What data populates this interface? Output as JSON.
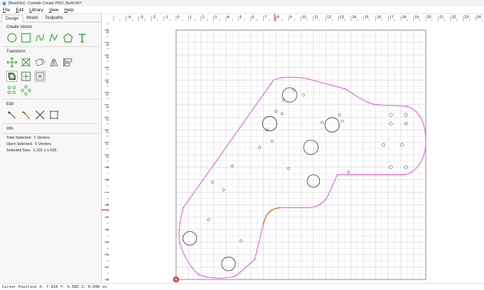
{
  "window": {
    "title": "[NewFile] - Carbide Create PRO, Build 807"
  },
  "menu": [
    "File",
    "Edit",
    "Library",
    "View",
    "Help"
  ],
  "tabs": [
    {
      "label": "Design",
      "active": true
    },
    {
      "label": "Model",
      "active": false
    },
    {
      "label": "Toolpaths",
      "active": false
    }
  ],
  "sections": {
    "create_vector": "Create Vector",
    "transform": "Transform",
    "edit": "Edit",
    "info": "Info"
  },
  "create_tools": [
    "circle-icon",
    "rectangle-icon",
    "curve-icon",
    "polyline-icon",
    "polygon-icon",
    "text-icon"
  ],
  "transform_tools_row1": [
    "move-icon",
    "scale-icon",
    "rotate-icon",
    "mirror-icon",
    "align-icon"
  ],
  "transform_tools_row2": [
    "offset-icon",
    "join-icon",
    "boolean-icon"
  ],
  "transform_tools_row3": [
    "circular-pattern-icon",
    "linear-pattern-icon"
  ],
  "edit_tools": [
    "node-edit-icon",
    "trim-icon",
    "cut-icon",
    "bounding-box-icon"
  ],
  "info": {
    "total_selected_label": "Total Selected:",
    "total_selected_value": "1 Vectors",
    "open_selected_label": "Open Selected:",
    "open_selected_value": "0 Vectors",
    "selected_size_label": "Selected Size:",
    "selected_size_value": "1.231 x 1.035"
  },
  "ruler": {
    "x_labels": [
      "-4",
      "-3",
      "-2",
      "-1",
      "0",
      "1",
      "2",
      "3",
      "4",
      "5",
      "6",
      "7",
      "8",
      "9",
      "10",
      "11",
      "12",
      "13",
      "14",
      "15",
      "16",
      "17",
      "18",
      "19",
      "20",
      "21",
      "22",
      "23",
      "24"
    ],
    "y_labels": [
      "20",
      "19",
      "18",
      "17",
      "16",
      "15",
      "14",
      "13",
      "12",
      "11",
      "10",
      "9",
      "8",
      "7",
      "6",
      "5",
      "4",
      "3",
      "2",
      "1",
      "0"
    ],
    "cursor_x": 7.91,
    "cursor_y": 5.585
  },
  "colors": {
    "outline": "#e040e0",
    "selected_segment": "#d2691e",
    "cursor_marker": "#e03030",
    "tool_green": "#3aa63a"
  },
  "status": {
    "cursor_position": "Cursor Position X: 7.910 Y: 5.585 Z: 0.000 in"
  }
}
